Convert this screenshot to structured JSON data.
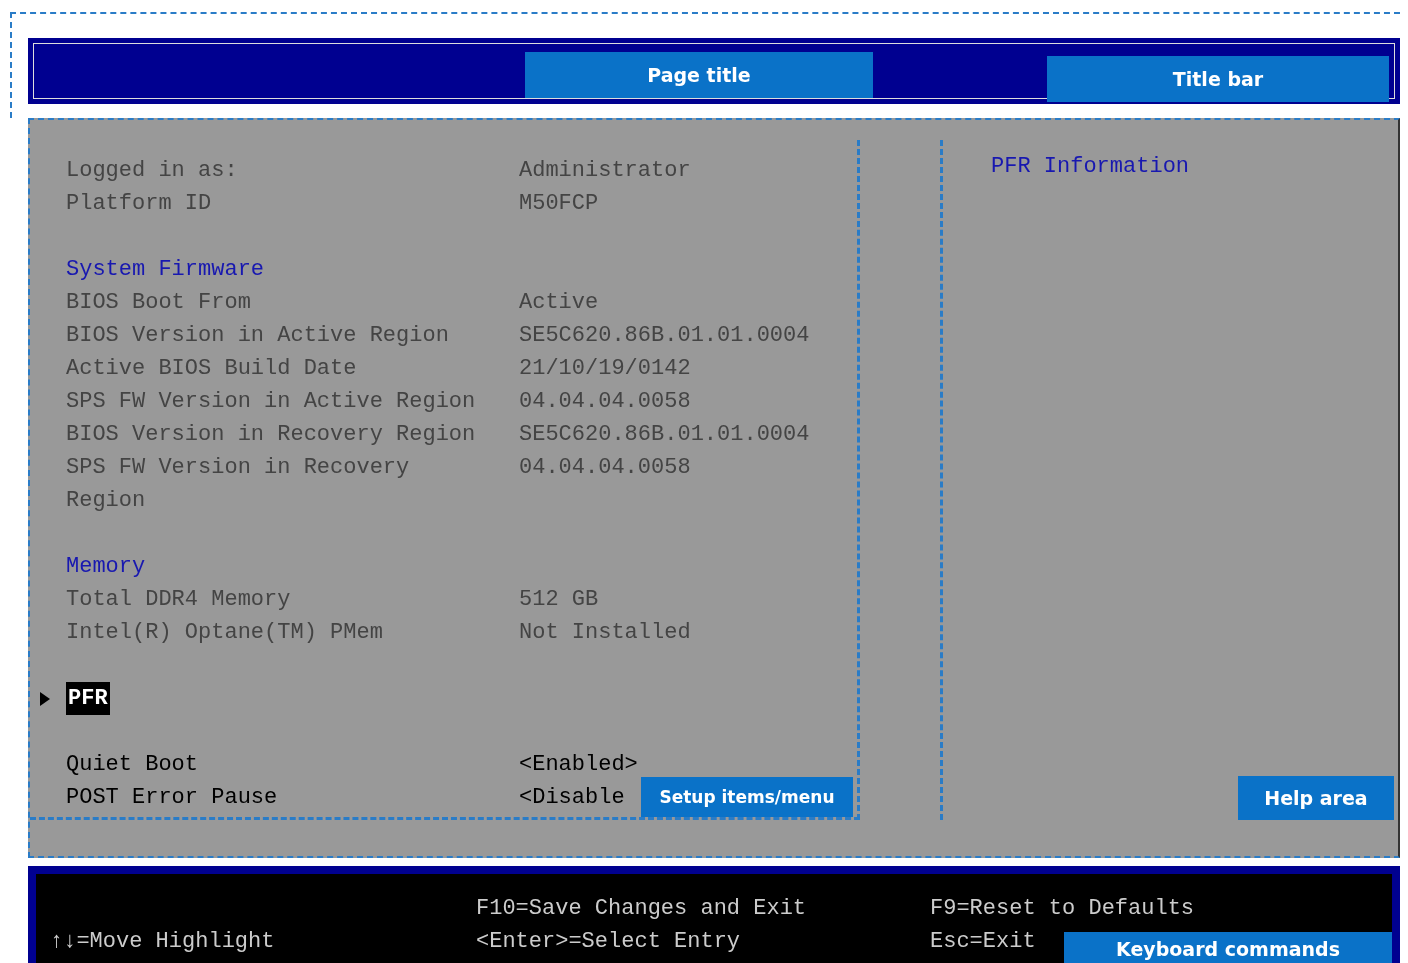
{
  "title_bar": {
    "callouts": [
      {
        "text": "Page title",
        "kind": "page"
      },
      {
        "text": "Title bar",
        "kind": "bar"
      }
    ]
  },
  "setup_items": {
    "sections": [
      {
        "rows": [
          {
            "kind": "info",
            "label": "Logged in as:",
            "value": "Administrator"
          },
          {
            "kind": "info",
            "label": "Platform ID",
            "value": "M50FCP"
          }
        ]
      },
      {
        "heading": "System Firmware",
        "rows": [
          {
            "kind": "info",
            "label": "BIOS Boot From",
            "value": "Active"
          },
          {
            "kind": "info",
            "label": "BIOS Version in Active Region",
            "value": "SE5C620.86B.01.01.0004"
          },
          {
            "kind": "info",
            "label": "Active BIOS Build Date",
            "value": "21/10/19/0142"
          },
          {
            "kind": "info",
            "label": "SPS FW Version in Active Region",
            "value": "04.04.04.0058"
          },
          {
            "kind": "info",
            "label": "BIOS Version in Recovery Region",
            "value": "SE5C620.86B.01.01.0004"
          },
          {
            "kind": "info",
            "label": "SPS FW Version in Recovery Region",
            "value": "04.04.04.0058"
          }
        ]
      },
      {
        "heading": "Memory",
        "rows": [
          {
            "kind": "info",
            "label": "Total DDR4 Memory",
            "value": "512 GB"
          },
          {
            "kind": "info",
            "label": "Intel(R) Optane(TM) PMem",
            "value": "Not Installed"
          }
        ]
      },
      {
        "rows": [
          {
            "kind": "submenu",
            "label": "PFR",
            "selected": true
          }
        ]
      },
      {
        "rows": [
          {
            "kind": "option",
            "label": "Quiet Boot",
            "value": "<Enabled>"
          },
          {
            "kind": "option",
            "label": "POST Error Pause",
            "value": "<Disable"
          }
        ]
      }
    ],
    "callout": "Setup items/menu"
  },
  "help_area": {
    "heading": "PFR Information",
    "callout": "Help area"
  },
  "keyboard_commands": {
    "columns": [
      [
        "↑↓=Move Highlight"
      ],
      [
        "F10=Save Changes and Exit",
        "<Enter>=Select Entry"
      ],
      [
        "F9=Reset to Defaults",
        "Esc=Exit"
      ]
    ],
    "callout": "Keyboard commands"
  }
}
